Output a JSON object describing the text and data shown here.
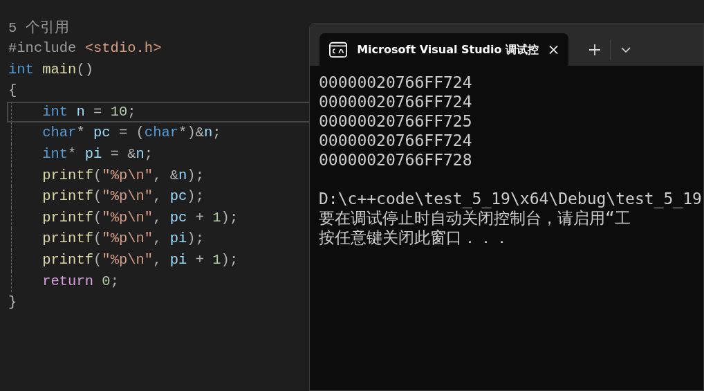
{
  "editor": {
    "codelens": "5 个引用",
    "lines": [
      {
        "current": false,
        "guide": false,
        "indented": false,
        "tokens": [
          {
            "text": "#include ",
            "kind": "preproc"
          },
          {
            "text": "<stdio.h>",
            "kind": "string"
          }
        ]
      },
      {
        "current": false,
        "guide": false,
        "indented": false,
        "tokens": [
          {
            "text": "int",
            "kind": "keyword"
          },
          {
            "text": " main",
            "kind": "function"
          },
          {
            "text": "()",
            "kind": "punct"
          }
        ]
      },
      {
        "current": false,
        "guide": false,
        "indented": false,
        "tokens": [
          {
            "text": "{",
            "kind": "punct"
          }
        ]
      },
      {
        "current": true,
        "guide": true,
        "indented": true,
        "tokens": [
          {
            "text": "int",
            "kind": "keyword"
          },
          {
            "text": " n",
            "kind": "variable"
          },
          {
            "text": " = ",
            "kind": "punct"
          },
          {
            "text": "10",
            "kind": "number"
          },
          {
            "text": ";",
            "kind": "punct"
          }
        ]
      },
      {
        "current": false,
        "guide": true,
        "indented": true,
        "tokens": [
          {
            "text": "char",
            "kind": "keyword"
          },
          {
            "text": "* ",
            "kind": "punct"
          },
          {
            "text": "pc",
            "kind": "variable"
          },
          {
            "text": " = (",
            "kind": "punct"
          },
          {
            "text": "char",
            "kind": "keyword"
          },
          {
            "text": "*)&",
            "kind": "punct"
          },
          {
            "text": "n",
            "kind": "variable"
          },
          {
            "text": ";",
            "kind": "punct"
          }
        ]
      },
      {
        "current": false,
        "guide": true,
        "indented": true,
        "tokens": [
          {
            "text": "int",
            "kind": "keyword"
          },
          {
            "text": "* ",
            "kind": "punct"
          },
          {
            "text": "pi",
            "kind": "variable"
          },
          {
            "text": " = &",
            "kind": "punct"
          },
          {
            "text": "n",
            "kind": "variable"
          },
          {
            "text": ";",
            "kind": "punct"
          }
        ]
      },
      {
        "current": false,
        "guide": true,
        "indented": true,
        "tokens": [
          {
            "text": "printf",
            "kind": "function"
          },
          {
            "text": "(",
            "kind": "punct"
          },
          {
            "text": "\"%p\\n\"",
            "kind": "string"
          },
          {
            "text": ", &",
            "kind": "punct"
          },
          {
            "text": "n",
            "kind": "variable"
          },
          {
            "text": ");",
            "kind": "punct"
          }
        ]
      },
      {
        "current": false,
        "guide": true,
        "indented": true,
        "tokens": [
          {
            "text": "printf",
            "kind": "function"
          },
          {
            "text": "(",
            "kind": "punct"
          },
          {
            "text": "\"%p\\n\"",
            "kind": "string"
          },
          {
            "text": ", ",
            "kind": "punct"
          },
          {
            "text": "pc",
            "kind": "variable"
          },
          {
            "text": ");",
            "kind": "punct"
          }
        ]
      },
      {
        "current": false,
        "guide": true,
        "indented": true,
        "tokens": [
          {
            "text": "printf",
            "kind": "function"
          },
          {
            "text": "(",
            "kind": "punct"
          },
          {
            "text": "\"%p\\n\"",
            "kind": "string"
          },
          {
            "text": ", ",
            "kind": "punct"
          },
          {
            "text": "pc",
            "kind": "variable"
          },
          {
            "text": " + ",
            "kind": "punct"
          },
          {
            "text": "1",
            "kind": "number"
          },
          {
            "text": ");",
            "kind": "punct"
          }
        ]
      },
      {
        "current": false,
        "guide": true,
        "indented": true,
        "tokens": [
          {
            "text": "printf",
            "kind": "function"
          },
          {
            "text": "(",
            "kind": "punct"
          },
          {
            "text": "\"%p\\n\"",
            "kind": "string"
          },
          {
            "text": ", ",
            "kind": "punct"
          },
          {
            "text": "pi",
            "kind": "variable"
          },
          {
            "text": ");",
            "kind": "punct"
          }
        ]
      },
      {
        "current": false,
        "guide": true,
        "indented": true,
        "tokens": [
          {
            "text": "printf",
            "kind": "function"
          },
          {
            "text": "(",
            "kind": "punct"
          },
          {
            "text": "\"%p\\n\"",
            "kind": "string"
          },
          {
            "text": ", ",
            "kind": "punct"
          },
          {
            "text": "pi",
            "kind": "variable"
          },
          {
            "text": " + ",
            "kind": "punct"
          },
          {
            "text": "1",
            "kind": "number"
          },
          {
            "text": ");",
            "kind": "punct"
          }
        ]
      },
      {
        "current": false,
        "guide": true,
        "indented": true,
        "tokens": [
          {
            "text": "return",
            "kind": "control"
          },
          {
            "text": " 0",
            "kind": "number"
          },
          {
            "text": ";",
            "kind": "punct"
          }
        ]
      },
      {
        "current": false,
        "guide": false,
        "indented": false,
        "tokens": [
          {
            "text": "}",
            "kind": "punct"
          }
        ]
      }
    ]
  },
  "terminal": {
    "tabs": [
      {
        "title": "Microsoft Visual Studio 调试控",
        "selected": true
      }
    ],
    "output_blocks": [
      {
        "lines": [
          "00000020766FF724",
          "00000020766FF724",
          "00000020766FF725",
          "00000020766FF724",
          "00000020766FF728"
        ]
      },
      {
        "lines": [
          "D:\\c++code\\test_5_19\\x64\\Debug\\test_5_19",
          "要在调试停止时自动关闭控制台，请启用“工",
          "按任意键关闭此窗口．．．"
        ]
      }
    ]
  }
}
